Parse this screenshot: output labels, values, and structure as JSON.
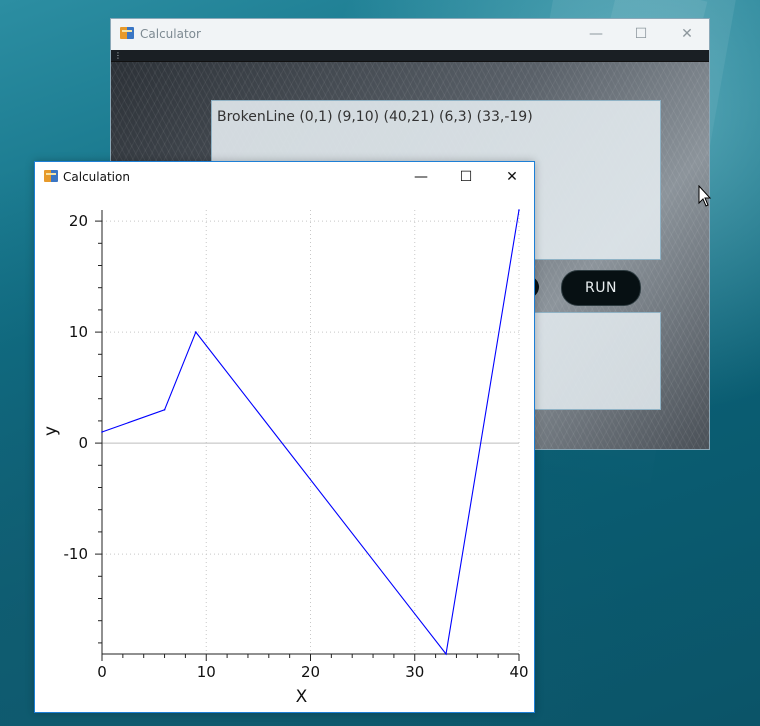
{
  "calculator": {
    "title": "Calculator",
    "input_text": "BrokenLine (0,1)  (9,10) (40,21) (6,3) (33,-19)",
    "run_label": "RUN",
    "window_controls": {
      "minimize": "—",
      "maximize": "☐",
      "close": "✕"
    }
  },
  "calculation_window": {
    "title": "Calculation",
    "window_controls": {
      "minimize": "—",
      "maximize": "☐",
      "close": "✕"
    }
  },
  "icons": {
    "app": "calculator-app-icon",
    "cursor": "mouse-pointer-icon"
  },
  "chart_data": {
    "type": "line",
    "x": [
      0,
      6,
      9,
      33,
      40
    ],
    "y": [
      1,
      3,
      10,
      -19,
      21
    ],
    "xlabel": "X",
    "ylabel": "y",
    "xlim": [
      0,
      40
    ],
    "ylim": [
      -19,
      21
    ],
    "xticks": [
      0,
      10,
      20,
      30,
      40
    ],
    "yticks": [
      -10,
      0,
      10,
      20
    ],
    "grid": true,
    "series_color": "#0000ff",
    "zero_line_color": "#bdbdbd"
  }
}
